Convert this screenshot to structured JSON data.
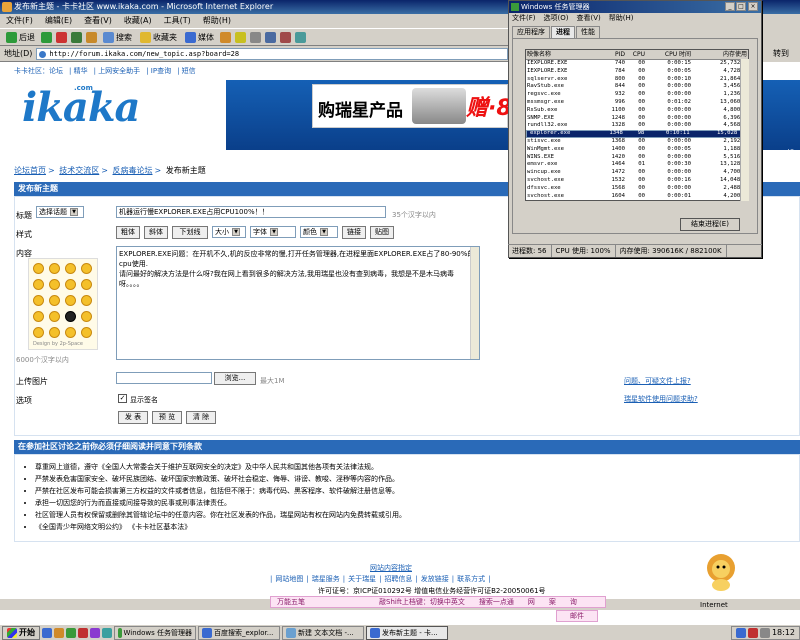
{
  "ie": {
    "title": "发布新主题 - 卡卡社区 www.ikaka.com - Microsoft Internet Explorer",
    "menu": [
      "文件(F)",
      "编辑(E)",
      "查看(V)",
      "收藏(A)",
      "工具(T)",
      "帮助(H)"
    ],
    "toolbar": {
      "back": "后退",
      "search": "搜索",
      "favorites": "收藏夹",
      "media": "媒体"
    },
    "address_label": "地址(D)",
    "address": "http://forum.ikaka.com/new_topic.asp?board=28",
    "go": "转到",
    "links": "链接",
    "status_right": "Internet"
  },
  "site": {
    "topnav": [
      "卡卡社区：论坛",
      "精华",
      "上网安全助手",
      "IP查询",
      "短信"
    ],
    "logo": "ikaka",
    "logo_com": ".com",
    "banner_text": "购瑞星产品",
    "banner_red": "赠·8",
    "help": "帮助",
    "breadcrumb": [
      "论坛首页",
      "技术交流区",
      "反病毒论坛",
      "发布新主题"
    ],
    "breadcrumb_sep": ">"
  },
  "form": {
    "header": "发布新主题",
    "title_label": "标题",
    "topic_select": "选择话题",
    "title_value": "机器运行慢EXPLORER.EXE占用CPU100%！！",
    "title_hint": "35个汉字以内",
    "style_label": "样式",
    "style_buttons": [
      "粗体",
      "斜体",
      "下划线"
    ],
    "size_select": "大小",
    "font_select": "字体",
    "color_select": "颜色",
    "link_btn": "链接",
    "image_btn": "贴图",
    "content_label": "内容",
    "content": "EXPLORER.EXE问题：在开机不久,机的反应非常的慢,打开任务管理器,在进程里面EXPLORER.EXE占了80-90%的cpu使用.\n请问最好的解决方法是什么呀?我在网上看到很多的解决方法,我用瑞星也没有查到病毒，我想是不是木马病毒呀。。。。",
    "emoji_credit": "Design by 2p-Space",
    "content_hint": "6000个汉字以内",
    "upload_label": "上传图片",
    "browse_btn": "浏览...",
    "upload_hint": "最大1M",
    "options_label": "选项",
    "show_sig": "显示签名",
    "submit": "发 表",
    "preview": "预 览",
    "clear": "清 除",
    "side_link1": "问题、可疑文件上报?",
    "side_link2": "瑞星软件使用问题求助?"
  },
  "notice": {
    "header": "在参加社区讨论之前你必须仔细阅读并同意下列条款",
    "items": [
      "尊重网上道德，遵守《全国人大常委会关于维护互联网安全的决定》及中华人民共和国其他各项有关法律法规。",
      "严禁发表危害国家安全、破坏民族团结、破坏国家宗教政策、破坏社会稳定、侮辱、诽谤、教唆、淫秽等内容的作品。",
      "严禁在社区发布可能会损害第三方权益的文件或者信息，包括但不限于：病毒代码、黑客程序、软件破解注册信息等。",
      "承担一切因您的行为而直接或间接导致的民事或刑事法律责任。",
      "社区管理人员有权保留或删除其管辖论坛中的任意内容。你在社区发表的作品，瑞星网站有权在网站内免费转载或引用。",
      "《全国青少年网络文明公约》 《卡卡社区基本法》"
    ]
  },
  "footer": {
    "guide": "网站内容指定",
    "links": [
      "网站地图",
      "瑞星服务",
      "关于瑞星",
      "招聘信息",
      "发放链接",
      "联系方式"
    ],
    "icp": "许可证号：京ICP证010292号 增值电信业务经营许可证B2-20050061号"
  },
  "ime": {
    "name": "万能五笔",
    "switch": "敲Shift上档键：切换中英文",
    "search": "搜索一点通",
    "items": [
      "网",
      "案",
      "询"
    ],
    "mail": "邮件"
  },
  "taskbar": {
    "start": "开始",
    "tasks": [
      "Windows 任务管理器",
      "百度搜索_explor...",
      "新建 文本文档 -...",
      "发布新主题 - 卡..."
    ],
    "clock": "18:12",
    "lang": "CH"
  },
  "taskmgr": {
    "title": "Windows 任务管理器",
    "menu": [
      "文件(F)",
      "选项(O)",
      "查看(V)",
      "帮助(H)"
    ],
    "tabs": [
      "应用程序",
      "进程",
      "性能"
    ],
    "active_tab": 1,
    "columns": [
      "映像名称",
      "PID",
      "CPU",
      "CPU 时间",
      "内存使用"
    ],
    "rows": [
      [
        "IEXPLORE.EXE",
        "740",
        "00",
        "0:00:15",
        "25,732 K"
      ],
      [
        "IEXPLORE.EXE",
        "784",
        "00",
        "0:00:05",
        "4,728 K"
      ],
      [
        "sqlservr.exe",
        "800",
        "00",
        "0:00:10",
        "21,864 K"
      ],
      [
        "RavStub.exe",
        "844",
        "00",
        "0:00:00",
        "3,456 K"
      ],
      [
        "regsvc.exe",
        "932",
        "00",
        "0:00:00",
        "1,236 K"
      ],
      [
        "mssmsgr.exe",
        "996",
        "00",
        "0:01:02",
        "13,060 K"
      ],
      [
        "RsSub.exe",
        "1100",
        "00",
        "0:00:00",
        "4,800 K"
      ],
      [
        "SNMP.EXE",
        "1248",
        "00",
        "0:00:00",
        "6,396 K"
      ],
      [
        "rundll32.exe",
        "1328",
        "00",
        "0:00:00",
        "4,568 K"
      ],
      [
        "explorer.exe",
        "1348",
        "98",
        "0:10:11",
        "15,028 K"
      ],
      [
        "stisvc.exe",
        "1368",
        "00",
        "0:00:00",
        "2,192 K"
      ],
      [
        "WinMgmt.exe",
        "1400",
        "00",
        "0:00:05",
        "1,188 K"
      ],
      [
        "WINS.EXE",
        "1420",
        "00",
        "0:00:00",
        "5,516 K"
      ],
      [
        "emsvr.exe",
        "1464",
        "01",
        "0:00:30",
        "13,128 K"
      ],
      [
        "wincup.exe",
        "1472",
        "00",
        "0:00:00",
        "4,700 K"
      ],
      [
        "svchost.exe",
        "1532",
        "00",
        "0:00:16",
        "14,048 K"
      ],
      [
        "dfssvc.exe",
        "1568",
        "00",
        "0:00:00",
        "2,488 K"
      ],
      [
        "svchost.exe",
        "1604",
        "00",
        "0:00:01",
        "4,200 K"
      ]
    ],
    "selected_row": 9,
    "end_process": "结束进程(E)",
    "status": {
      "procs": "进程数: 56",
      "cpu": "CPU 使用: 100%",
      "mem": "内存使用: 390616K / 882100K"
    }
  }
}
